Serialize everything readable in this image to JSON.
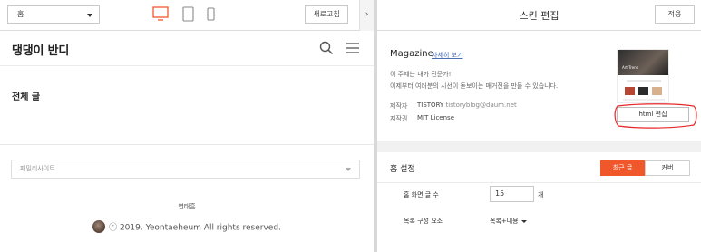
{
  "toolbar": {
    "page_select": "홈",
    "refresh_label": "새로고침",
    "collapse_glyph": "›"
  },
  "preview": {
    "blog_title": "댕댕이 반디",
    "section_title": "전체 글",
    "family_site_placeholder": "패밀리사이트",
    "footer_name": "연태흠",
    "copyright": "ⓒ 2019. Yeontaeheum All rights reserved."
  },
  "panel": {
    "title": "스킨 편집",
    "apply_label": "적용"
  },
  "skin": {
    "name": "Magazine",
    "more_link": "자세히 보기",
    "desc_line1": "이 주제는 내가 전문가!",
    "desc_line2": "이제부터 여러분의 시선이 돋보이는 매거진을 만들 수 있습니다.",
    "maker_label": "제작자",
    "maker_value": "TISTORY",
    "maker_email": "tistoryblog@daum.net",
    "license_label": "저작권",
    "license_value": "MIT License",
    "thumb_label": "Art Trend",
    "html_edit_label": "html 편집"
  },
  "home_settings": {
    "title": "홈 설정",
    "tab_recent": "최근 글",
    "tab_cover": "커버",
    "posts_count_label": "홈 화면 글 수",
    "posts_count_value": "15",
    "posts_count_unit": "개",
    "list_config_label": "목록 구성 요소",
    "list_config_value": "목록+내용"
  },
  "colors": {
    "accent": "#f0582b",
    "desktop_icon": "#f0582b",
    "link": "#4a6fb5",
    "annotation": "#e8262a"
  }
}
